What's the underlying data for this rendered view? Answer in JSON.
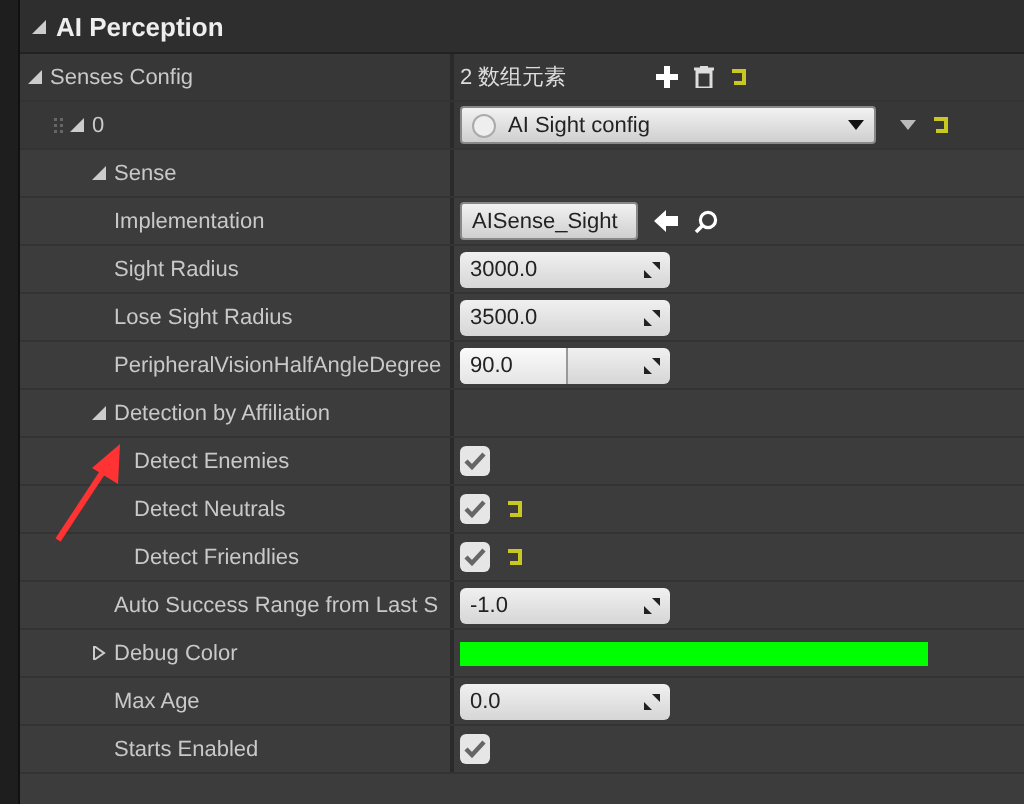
{
  "panel": {
    "title": "AI Perception",
    "expanded": true
  },
  "rows": [
    {
      "label": "Senses Config",
      "expanded": true,
      "kind": "array",
      "value": "2 数组元素",
      "resettable": true,
      "children": [
        {
          "label": "0",
          "kind": "element",
          "expanded": true,
          "value": "AI Sight config",
          "resettable": true,
          "children": [
            {
              "label": "Sense",
              "expanded": true,
              "children": [
                {
                  "label": "Implementation",
                  "kind": "asset",
                  "value": "AISense_Sight"
                },
                {
                  "label": "Sight Radius",
                  "kind": "number",
                  "value": "3000.0"
                },
                {
                  "label": "Lose Sight Radius",
                  "kind": "number",
                  "value": "3500.0"
                },
                {
                  "label": "PeripheralVisionHalfAngleDegree",
                  "kind": "slider",
                  "value": "90.0",
                  "level": 0.5
                },
                {
                  "label": "Detection by Affiliation",
                  "expanded": true,
                  "children": [
                    {
                      "label": "Detect Enemies",
                      "kind": "checkbox",
                      "checked": true,
                      "resettable": false
                    },
                    {
                      "label": "Detect Neutrals",
                      "kind": "checkbox",
                      "checked": true,
                      "resettable": true
                    },
                    {
                      "label": "Detect Friendlies",
                      "kind": "checkbox",
                      "checked": true,
                      "resettable": true
                    }
                  ]
                },
                {
                  "label": "Auto Success Range from Last S",
                  "kind": "number",
                  "value": "-1.0"
                },
                {
                  "label": "Debug Color",
                  "kind": "color",
                  "expanded": false,
                  "color": "#00ff00"
                },
                {
                  "label": "Max Age",
                  "kind": "number",
                  "value": "0.0"
                },
                {
                  "label": "Starts Enabled",
                  "kind": "checkbox",
                  "checked": true,
                  "resettable": false
                }
              ]
            }
          ]
        }
      ]
    }
  ],
  "annotation": {
    "kind": "arrow"
  }
}
